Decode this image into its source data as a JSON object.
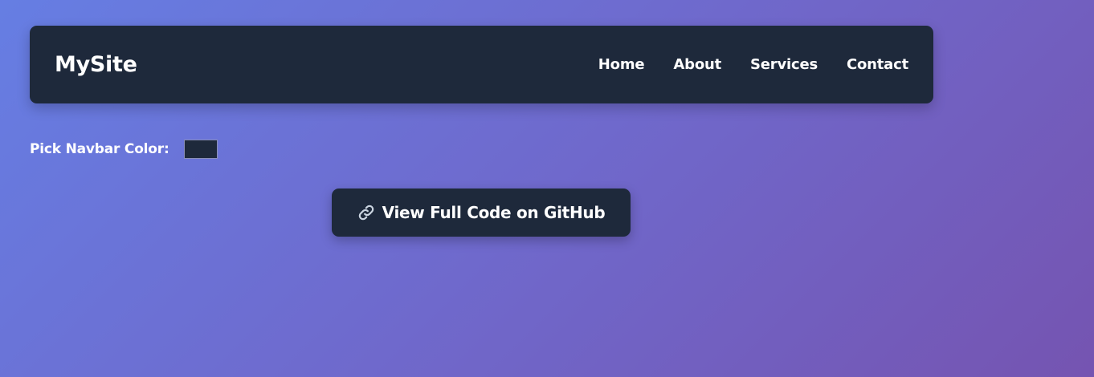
{
  "navbar": {
    "brand": "MySite",
    "background_color": "#1e293b",
    "links": [
      {
        "label": "Home"
      },
      {
        "label": "About"
      },
      {
        "label": "Services"
      },
      {
        "label": "Contact"
      }
    ]
  },
  "color_picker": {
    "label": "Pick Navbar Color:",
    "value": "#1e293b"
  },
  "github_button": {
    "icon": "link-icon",
    "label": "View Full Code on GitHub"
  },
  "colors": {
    "background_gradient_start": "#667ee3",
    "background_gradient_end": "#7554b1",
    "text": "#ffffff"
  }
}
